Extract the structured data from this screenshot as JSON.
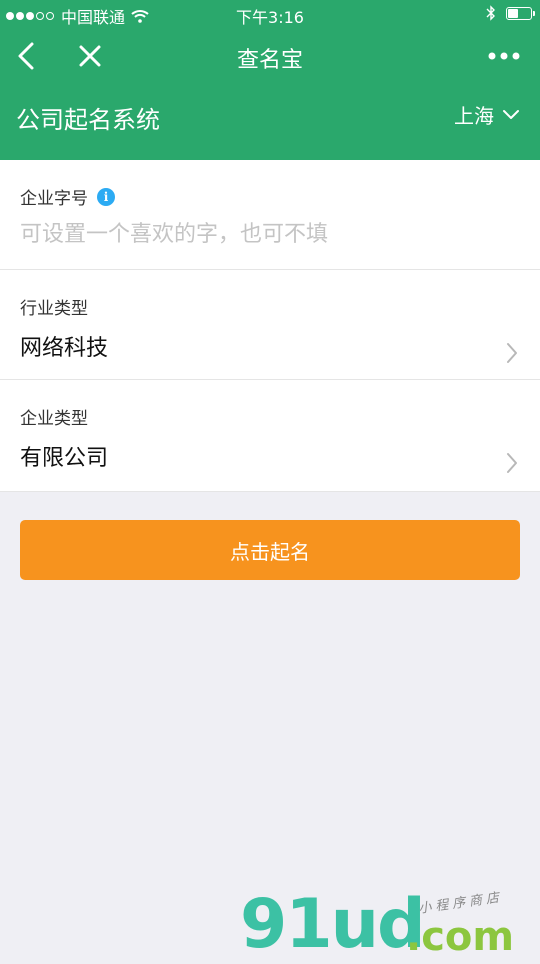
{
  "status_bar": {
    "carrier": "中国联通",
    "time": "下午3:16"
  },
  "nav": {
    "title": "查名宝"
  },
  "header": {
    "page_title": "公司起名系统",
    "city": "上海"
  },
  "form": {
    "brand_name": {
      "label": "企业字号",
      "value": "",
      "placeholder": "可设置一个喜欢的字，也可不填"
    },
    "industry": {
      "label": "行业类型",
      "value": "网络科技"
    },
    "company_type": {
      "label": "企业类型",
      "value": "有限公司"
    }
  },
  "submit_label": "点击起名",
  "watermark": {
    "main": "91ud",
    "dotcom": ".com",
    "tag": "小程序商店"
  },
  "colors": {
    "header_green": "#2aa86c",
    "button_orange": "#f7931e",
    "info_blue": "#2cabf3",
    "background": "#efeff4"
  }
}
